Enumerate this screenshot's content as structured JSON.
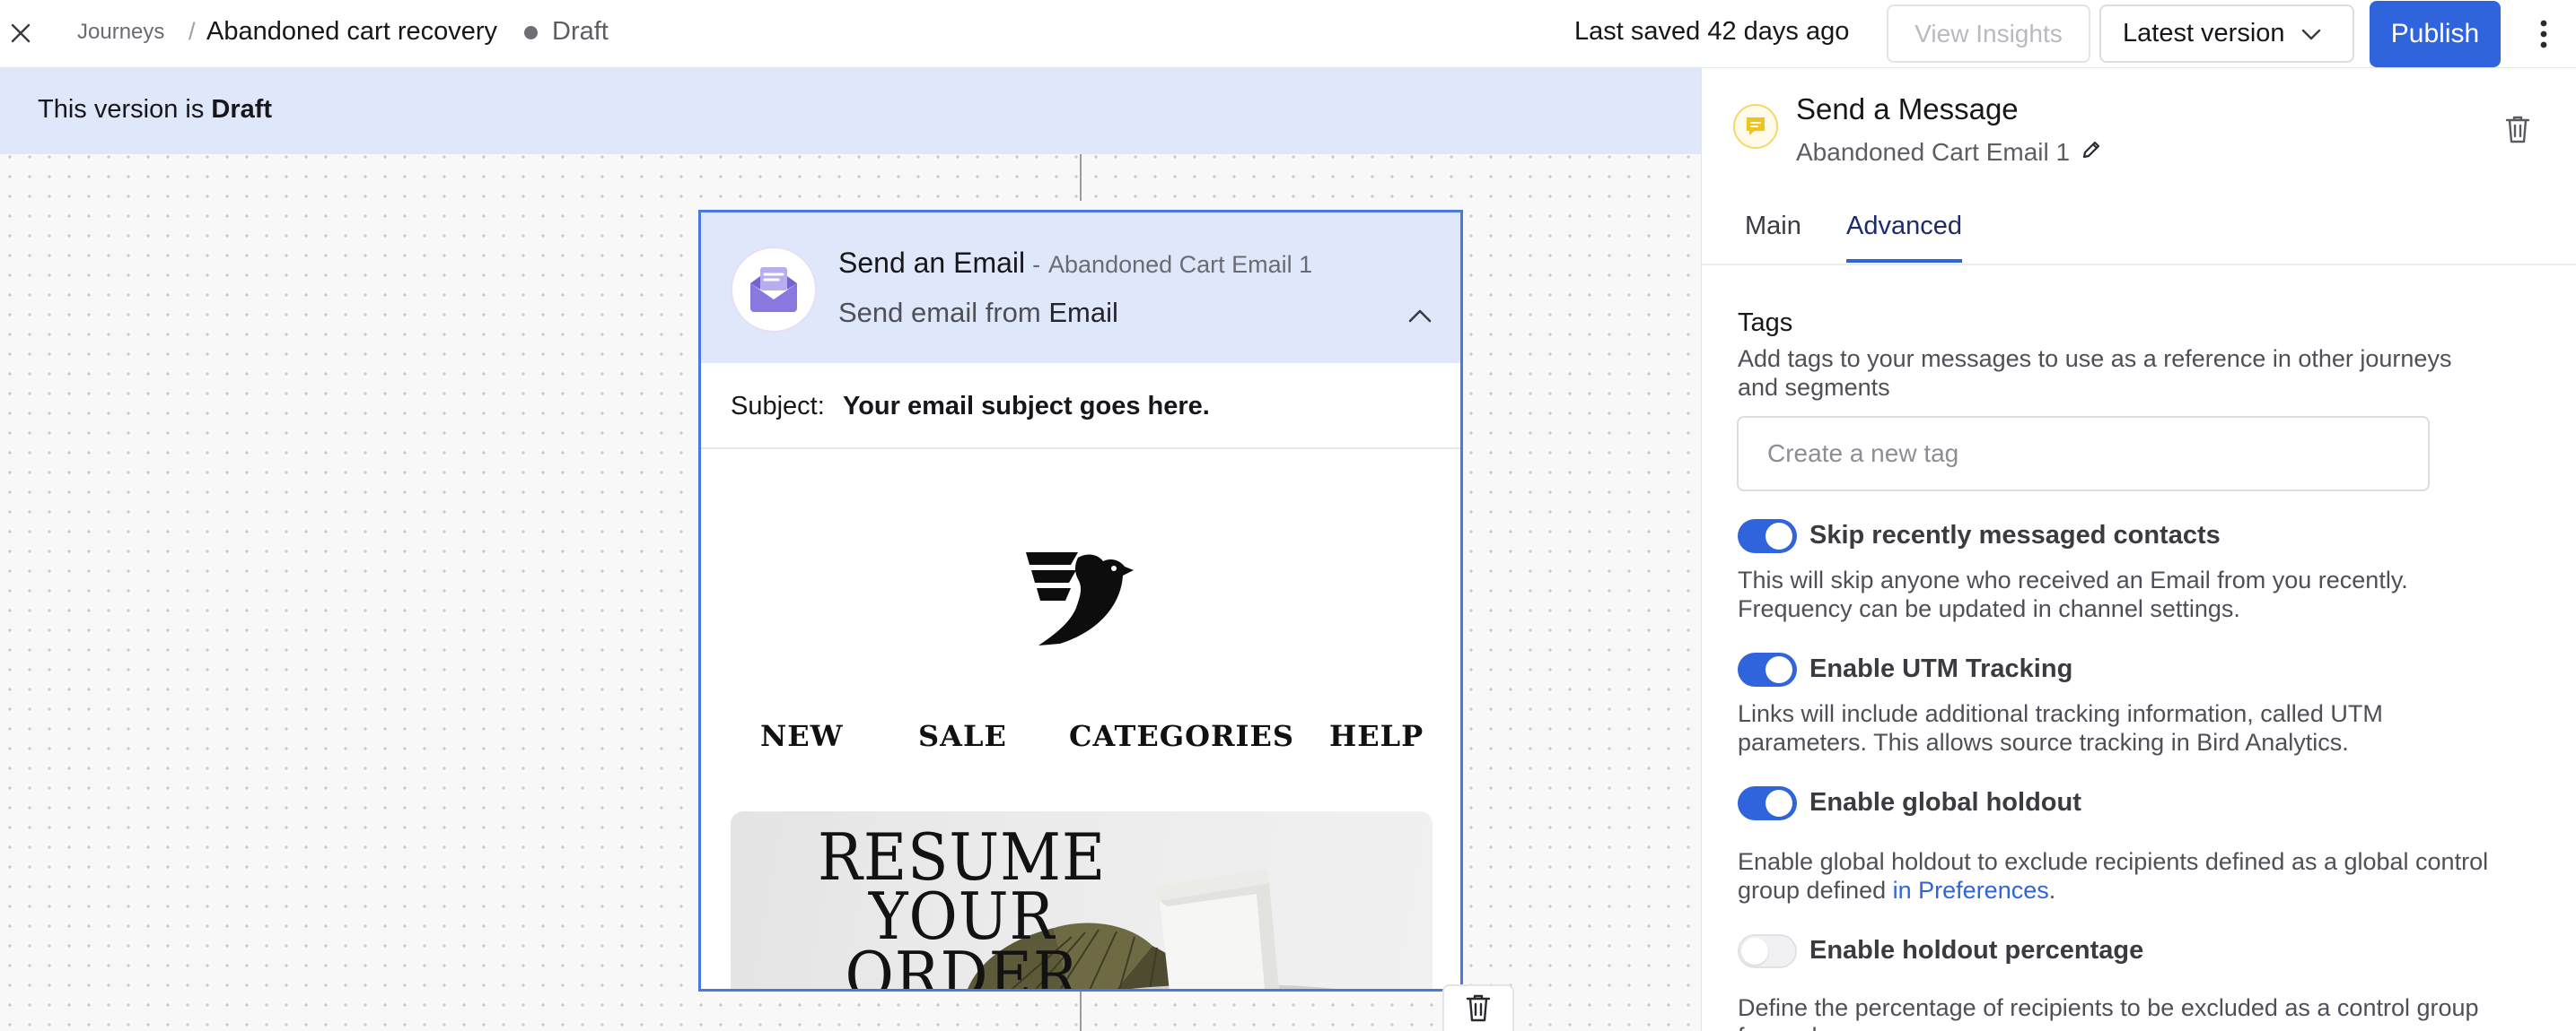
{
  "header": {
    "breadcrumb_root": "Journeys",
    "breadcrumb_sep": "/",
    "journey_title": "Abandoned cart recovery",
    "status": "Draft",
    "last_saved": "Last saved 42 days ago",
    "view_insights_label": "View Insights",
    "version_label": "Latest version",
    "publish_label": "Publish"
  },
  "canvas": {
    "banner_prefix": "This version is ",
    "banner_status": "Draft",
    "node": {
      "title": "Send an Email",
      "title_sep": "-",
      "title_sub": "Abandoned Cart Email 1",
      "subtitle_prefix": "Send email from ",
      "subtitle_channel": "Email",
      "subject_label": "Subject:",
      "subject_value": "Your email subject goes here.",
      "email_nav": [
        "NEW",
        "SALE",
        "CATEGORIES",
        "HELP"
      ],
      "hero_title_line1": "RESUME YOUR",
      "hero_title_line2": "ORDER"
    }
  },
  "panel": {
    "title": "Send a Message",
    "subtitle": "Abandoned Cart Email 1",
    "tabs": [
      {
        "label": "Main",
        "active": false
      },
      {
        "label": "Advanced",
        "active": true
      }
    ],
    "tags": {
      "title": "Tags",
      "description": "Add tags to your messages to use as a reference in other journeys and segments",
      "input_placeholder": "Create a new tag",
      "input_value": ""
    },
    "toggles": [
      {
        "label": "Skip recently messaged contacts",
        "on": true,
        "description": "This will skip anyone who received an Email from you recently. Frequency can be updated in channel settings."
      },
      {
        "label": "Enable UTM Tracking",
        "on": true,
        "description": "Links will include additional tracking information, called UTM parameters. This allows source tracking in Bird Analytics."
      },
      {
        "label": "Enable global holdout",
        "on": true,
        "description_prefix": "Enable global holdout to exclude recipients defined as a global control group defined ",
        "description_link": "in Preferences",
        "description_suffix": "."
      },
      {
        "label": "Enable holdout percentage",
        "on": false,
        "description": "Define the percentage of recipients to be excluded as a control group for each"
      }
    ]
  },
  "colors": {
    "accent": "#2f64dc",
    "banner": "#dfe7fa",
    "node_border": "#4a78dd",
    "icon_purple": "#8a78e0",
    "icon_yellow": "#f0c419"
  },
  "icons": {
    "close": "close-icon",
    "chevron_down": "chevron-down-icon",
    "more": "more-vertical-icon",
    "email": "email-open-icon",
    "chevron_up": "chevron-up-icon",
    "trash": "trash-icon",
    "message": "message-icon",
    "pencil": "pencil-icon"
  }
}
